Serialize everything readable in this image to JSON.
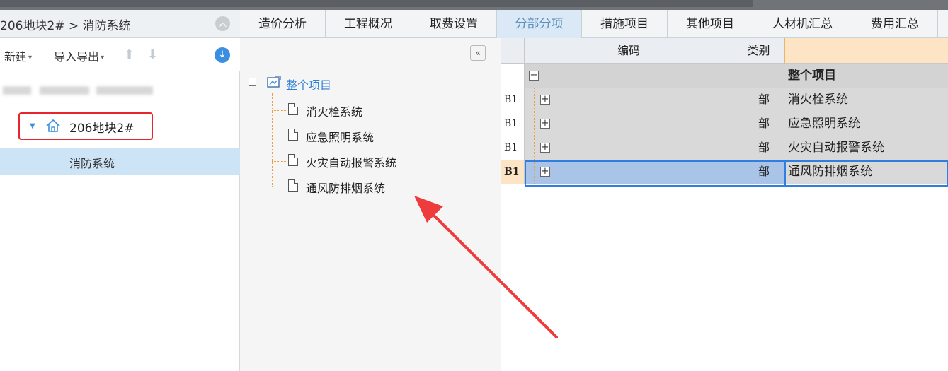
{
  "left": {
    "breadcrumb": "206地块2# > 消防系统",
    "toolbar": {
      "new_label": "新建",
      "import_export_label": "导入导出"
    },
    "tree": {
      "root_label": "206地块2#",
      "child_label": "消防系统"
    }
  },
  "tabs": [
    {
      "label": "造价分析"
    },
    {
      "label": "工程概况"
    },
    {
      "label": "取费设置"
    },
    {
      "label": "分部分项",
      "active": true
    },
    {
      "label": "措施项目"
    },
    {
      "label": "其他项目"
    },
    {
      "label": "人材机汇总"
    },
    {
      "label": "费用汇总"
    }
  ],
  "middle": {
    "root_label": "整个项目",
    "items": [
      "消火栓系统",
      "应急照明系统",
      "火灾自动报警系统",
      "通风防排烟系统"
    ]
  },
  "grid": {
    "headers": {
      "code": "编码",
      "type": "类别"
    },
    "rows": [
      {
        "rownum": "",
        "toggle": "−",
        "type": "",
        "name": "整个项目"
      },
      {
        "rownum": "B1",
        "toggle": "+",
        "type": "部",
        "name": "消火栓系统"
      },
      {
        "rownum": "B1",
        "toggle": "+",
        "type": "部",
        "name": "应急照明系统"
      },
      {
        "rownum": "B1",
        "toggle": "+",
        "type": "部",
        "name": "火灾自动报警系统"
      },
      {
        "rownum": "B1",
        "toggle": "+",
        "type": "部",
        "name": "通风防排烟系统"
      }
    ]
  },
  "colors": {
    "accent_blue": "#2f7ee0",
    "highlight_red": "#e8242c",
    "arrow_red": "#ee3b3b",
    "active_tab_text": "#5a8fc0"
  }
}
